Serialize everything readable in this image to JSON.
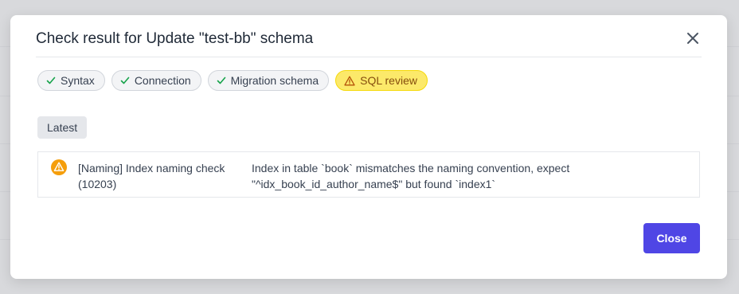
{
  "dialog": {
    "title": "Check result for Update \"test-bb\" schema",
    "close_icon": "close-icon"
  },
  "tabs": [
    {
      "label": "Syntax",
      "status": "success",
      "icon": "check-icon"
    },
    {
      "label": "Connection",
      "status": "success",
      "icon": "check-icon"
    },
    {
      "label": "Migration schema",
      "status": "success",
      "icon": "check-icon"
    },
    {
      "label": "SQL review",
      "status": "warning",
      "icon": "warning-triangle-icon",
      "active": true
    }
  ],
  "result_filter": {
    "label": "Latest"
  },
  "results": [
    {
      "status": "warning",
      "icon": "warning-circle-icon",
      "rule": "[Naming] Index naming check (10203)",
      "message": "Index in table `book` mismatches the naming convention, expect \"^idx_book_id_author_name$\" but found `index1`"
    }
  ],
  "footer": {
    "close_label": "Close"
  },
  "colors": {
    "primary": "#4f46e5",
    "warning_tab_bg": "#fce96a",
    "warning_icon": "#f59e0b",
    "success_check": "#16a34a"
  }
}
